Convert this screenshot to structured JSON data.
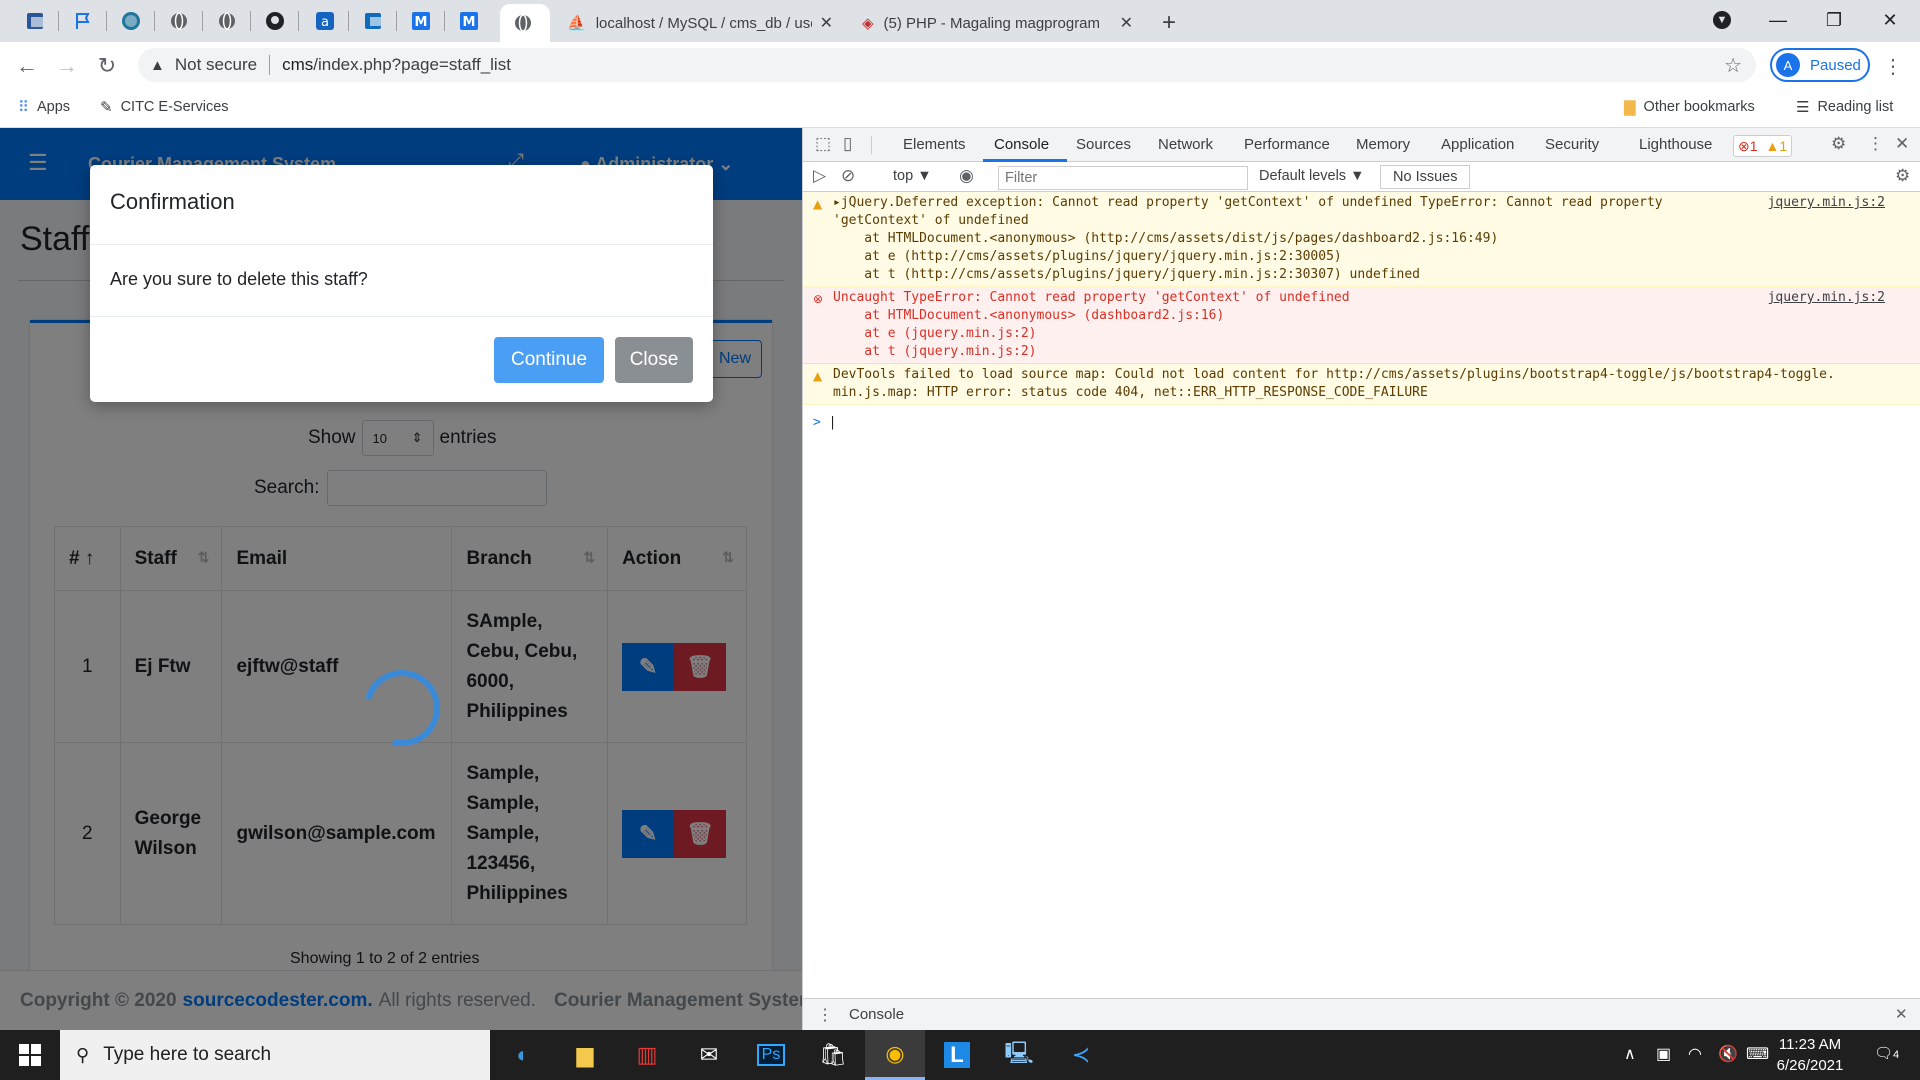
{
  "browser": {
    "tabs": [
      {
        "title": "localhost / MySQL / cms_db / use",
        "favicon": "phpmyadmin-icon"
      },
      {
        "title": "(5) PHP - Magaling magprogram",
        "favicon": "youtube-icon"
      }
    ],
    "address": {
      "security": "Not secure",
      "url_host": "cms",
      "url_path": "/index.php?page=staff_list"
    },
    "profile": {
      "initial": "A",
      "status": "Paused"
    },
    "bookmarks": {
      "apps": "Apps",
      "citc": "CITC E-Services",
      "other": "Other bookmarks",
      "reading": "Reading list"
    }
  },
  "page": {
    "navbar": {
      "brand": "Courier Management System",
      "user": "Administrator"
    },
    "heading": "Staff",
    "new_button": "New",
    "show": {
      "label_before": "Show",
      "value": "10",
      "label_after": "entries"
    },
    "search": {
      "label": "Search:"
    },
    "table": {
      "headers": [
        "#",
        "Staff",
        "Email",
        "Branch",
        "Action"
      ],
      "rows": [
        {
          "num": "1",
          "staff": "Ej Ftw",
          "email": "ejftw@staff",
          "branch": [
            "SAmple,",
            "Cebu, Cebu,",
            "6000,",
            "Philippines"
          ]
        },
        {
          "num": "2",
          "staff": [
            "George",
            "Wilson"
          ],
          "email": "gwilson@sample.com",
          "branch": [
            "Sample,",
            "Sample,",
            "Sample,",
            "123456,",
            "Philippines"
          ]
        }
      ]
    },
    "info": "Showing 1 to 2 of 2 entries",
    "footer": {
      "copyright": "Copyright © 2020",
      "link": "sourcecodester.com.",
      "reserved": "All rights reserved.",
      "system": "Courier Management System"
    }
  },
  "modal": {
    "title": "Confirmation",
    "message": "Are you sure to delete this staff?",
    "continue": "Continue",
    "close": "Close"
  },
  "devtools": {
    "tabs": [
      "Elements",
      "Console",
      "Sources",
      "Network",
      "Performance",
      "Memory",
      "Application",
      "Security",
      "Lighthouse"
    ],
    "active_tab": "Console",
    "error_count": "1",
    "warning_count": "1",
    "context": "top",
    "filter_placeholder": "Filter",
    "levels": "Default levels",
    "issues": "No Issues",
    "messages": [
      {
        "level": "warning",
        "source": "jquery.min.js:2",
        "lines": [
          "jQuery.Deferred exception: Cannot read property 'getContext' of undefined TypeError: Cannot read property",
          "'getContext' of undefined",
          "    at HTMLDocument.<anonymous> (http://cms/assets/dist/js/pages/dashboard2.js:16:49)",
          "    at e (http://cms/assets/plugins/jquery/jquery.min.js:2:30005)",
          "    at t (http://cms/assets/plugins/jquery/jquery.min.js:2:30307) undefined"
        ]
      },
      {
        "level": "error",
        "source": "jquery.min.js:2",
        "lines": [
          "Uncaught TypeError: Cannot read property 'getContext' of undefined",
          "    at HTMLDocument.<anonymous> (dashboard2.js:16)",
          "    at e (jquery.min.js:2)",
          "    at t (jquery.min.js:2)"
        ]
      },
      {
        "level": "warning",
        "source": "",
        "lines": [
          "DevTools failed to load source map: Could not load content for http://cms/assets/plugins/bootstrap4-toggle/js/bootstrap4-toggle.",
          "min.js.map: HTTP error: status code 404, net::ERR_HTTP_RESPONSE_CODE_FAILURE"
        ]
      }
    ],
    "prompt": ">",
    "drawer_tab": "Console"
  },
  "taskbar": {
    "search_placeholder": "Type here to search",
    "time": "11:23 AM",
    "date": "6/26/2021",
    "notifications": "4"
  },
  "colors": {
    "primary": "#007bff",
    "danger": "#dc3545",
    "chrome_blue": "#1a73e8",
    "error_red": "#d93025",
    "warning_amber": "#e8a010"
  }
}
